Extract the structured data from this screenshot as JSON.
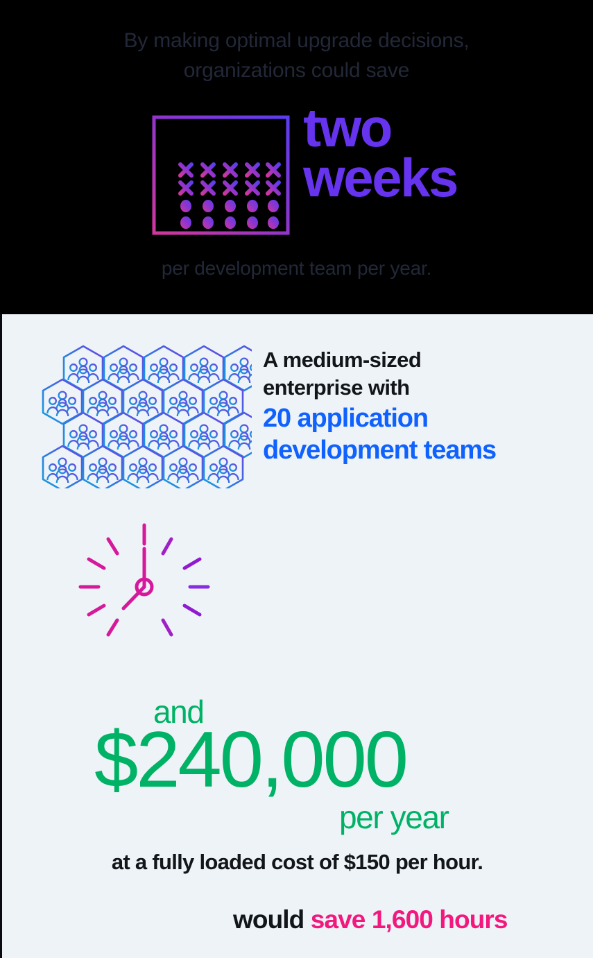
{
  "top_panel": {
    "background_color": "#000000",
    "intro_line1": "By making optimal upgrade decisions,",
    "intro_line2": "organizations could save",
    "headline_line1": "two",
    "headline_line2": "weeks",
    "headline_color": "#6633ee",
    "footnote": "per development team per year.",
    "calendar_icon_name": "calendar-icon",
    "calendar_gradient_from": "#d0379c",
    "calendar_gradient_to": "#5b3df0"
  },
  "bottom_panel": {
    "background_color": "#eef3f8",
    "teams": {
      "hex_icon_name": "people-hexagon-grid-icon",
      "hex_count": 20,
      "hex_rows": 4,
      "hex_cols": 5,
      "hex_gradient_from": "#1f9fd8",
      "hex_gradient_to": "#6a45e0",
      "line1": "A medium-sized",
      "line2": "enterprise with",
      "highlight_line1": "20 application",
      "highlight_line2": "development teams",
      "highlight_color": "#0f62fe",
      "text_color": "#121619"
    },
    "hours": {
      "clock_icon_name": "clock-icon",
      "clock_color": "#d6189b",
      "tick_gradient_from": "#f3e3ef",
      "tick_gradient_to": "#f2187d",
      "tick_rows": 4,
      "tick_columns": 43,
      "prefix": "would ",
      "highlight": "save 1,600 hours",
      "highlight_color": "#f2187d",
      "prefix_color": "#121619"
    },
    "money": {
      "and_word": "and",
      "amount": "$240,000",
      "per_year": "per year",
      "color": "#00b265"
    },
    "cost_note": "at a fully loaded cost of $150 per hour.",
    "cost_note_color": "#121619"
  }
}
